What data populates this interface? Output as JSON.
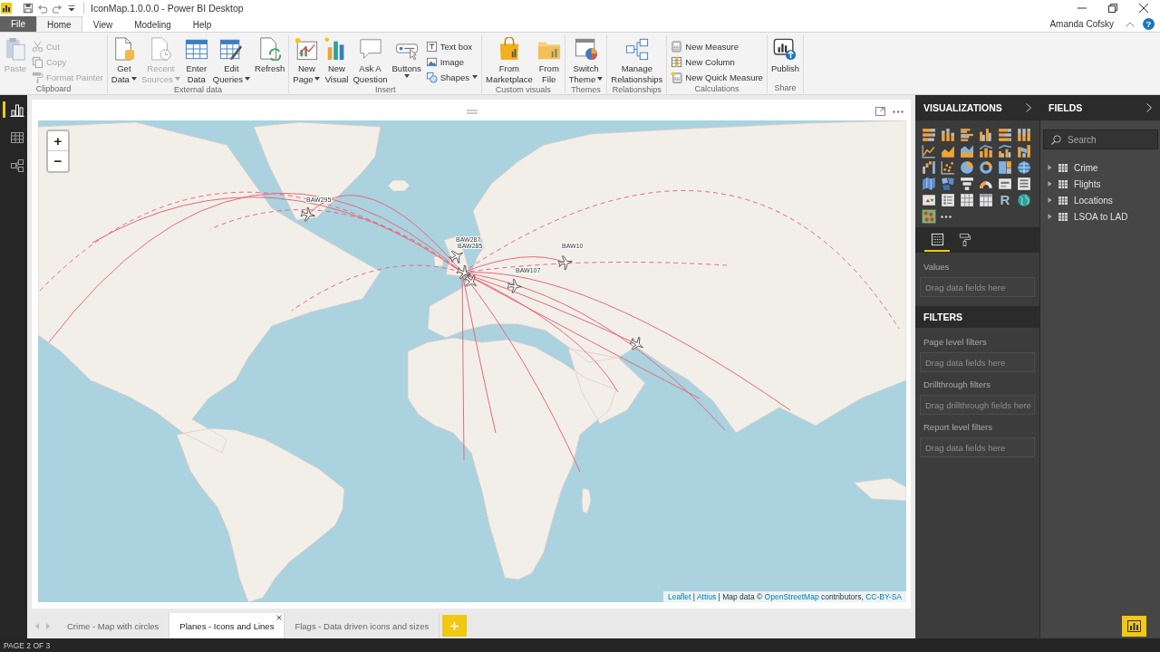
{
  "window": {
    "title": "IconMap.1.0.0.0 - Power BI Desktop"
  },
  "quick_access": [
    {
      "kind": "save"
    },
    {
      "kind": "undo"
    },
    {
      "kind": "redo"
    },
    {
      "kind": "customize"
    }
  ],
  "menu": {
    "file": "File",
    "tabs": [
      {
        "label": "Home",
        "selected": true
      },
      {
        "label": "View",
        "selected": false
      },
      {
        "label": "Modeling",
        "selected": false
      },
      {
        "label": "Help",
        "selected": false
      }
    ],
    "user": "Amanda Cofsky",
    "help": "?"
  },
  "ribbon": [
    {
      "label": "Clipboard",
      "items": [
        {
          "kind": "paste",
          "lines": [
            "Paste"
          ],
          "dropdown": false,
          "disabled": true
        },
        {
          "stack": [
            {
              "kind": "cut",
              "label": "Cut",
              "dropdown": false,
              "disabled": true
            },
            {
              "kind": "copy",
              "label": "Copy",
              "dropdown": false,
              "disabled": true
            },
            {
              "kind": "format-painter",
              "label": "Format Painter",
              "dropdown": false,
              "disabled": true
            }
          ]
        }
      ]
    },
    {
      "label": "External data",
      "items": [
        {
          "kind": "get-data",
          "lines": [
            "Get",
            "Data"
          ],
          "dropdown": true,
          "disabled": false
        },
        {
          "kind": "recent-sources",
          "lines": [
            "Recent",
            "Sources"
          ],
          "dropdown": true,
          "disabled": true
        },
        {
          "kind": "enter-data",
          "lines": [
            "Enter",
            "Data"
          ],
          "dropdown": false,
          "disabled": false
        },
        {
          "kind": "edit-queries",
          "lines": [
            "Edit",
            "Queries"
          ],
          "dropdown": true,
          "disabled": false
        },
        {
          "kind": "refresh",
          "lines": [
            "Refresh"
          ],
          "dropdown": false,
          "disabled": false
        }
      ]
    },
    {
      "label": "Insert",
      "items": [
        {
          "kind": "new-page",
          "lines": [
            "New",
            "Page"
          ],
          "dropdown": true,
          "disabled": false
        },
        {
          "kind": "new-visual",
          "lines": [
            "New",
            "Visual"
          ],
          "dropdown": false,
          "disabled": false
        },
        {
          "kind": "ask-a-question",
          "lines": [
            "Ask A",
            "Question"
          ],
          "dropdown": false,
          "disabled": false
        },
        {
          "kind": "buttons",
          "lines": [
            "Buttons"
          ],
          "dropdown": true,
          "disabled": false
        },
        {
          "stack": [
            {
              "kind": "text-box",
              "label": "Text box",
              "dropdown": false,
              "disabled": false
            },
            {
              "kind": "image",
              "label": "Image",
              "dropdown": false,
              "disabled": false
            },
            {
              "kind": "shapes",
              "label": "Shapes",
              "dropdown": true,
              "disabled": false
            }
          ]
        }
      ]
    },
    {
      "label": "Custom visuals",
      "items": [
        {
          "kind": "from-marketplace",
          "lines": [
            "From",
            "Marketplace"
          ],
          "dropdown": false,
          "disabled": false
        },
        {
          "kind": "from-file",
          "lines": [
            "From",
            "File"
          ],
          "dropdown": false,
          "disabled": false
        }
      ]
    },
    {
      "label": "Themes",
      "items": [
        {
          "kind": "switch-theme",
          "lines": [
            "Switch",
            "Theme"
          ],
          "dropdown": true,
          "disabled": false
        }
      ]
    },
    {
      "label": "Relationships",
      "items": [
        {
          "kind": "manage-relationships",
          "lines": [
            "Manage",
            "Relationships"
          ],
          "dropdown": false,
          "disabled": false
        }
      ]
    },
    {
      "label": "Calculations",
      "items": [
        {
          "stack": [
            {
              "kind": "new-measure",
              "label": "New Measure",
              "dropdown": false,
              "disabled": false
            },
            {
              "kind": "new-column",
              "label": "New Column",
              "dropdown": false,
              "disabled": false
            },
            {
              "kind": "new-quick-measure",
              "label": "New Quick Measure",
              "dropdown": false,
              "disabled": false
            }
          ]
        }
      ]
    },
    {
      "label": "Share",
      "items": [
        {
          "kind": "publish",
          "lines": [
            "Publish"
          ],
          "dropdown": false,
          "disabled": false
        }
      ]
    }
  ],
  "views": [
    {
      "kind": "report",
      "selected": true
    },
    {
      "kind": "data",
      "selected": false
    },
    {
      "kind": "model",
      "selected": false
    }
  ],
  "report": {
    "map": {
      "zoom_in": "+",
      "zoom_out": "−",
      "flights": [
        {
          "label": "BAW295"
        },
        {
          "label": "BAW287"
        },
        {
          "label": "BAW285"
        },
        {
          "label": "BAW10"
        },
        {
          "label": "BAW107"
        }
      ],
      "attribution": [
        {
          "kind": "link",
          "text": "Leaflet"
        },
        {
          "kind": "text",
          "text": "|"
        },
        {
          "kind": "link",
          "text": "Attius"
        },
        {
          "kind": "text",
          "text": "| Map data ©"
        },
        {
          "kind": "link",
          "text": "OpenStreetMap"
        },
        {
          "kind": "text",
          "text": "contributors,"
        },
        {
          "kind": "link",
          "text": "CC-BY-SA"
        }
      ]
    }
  },
  "page_tabs": [
    {
      "label": "Crime - Map with circles",
      "selected": false
    },
    {
      "label": "Planes - Icons and Lines",
      "selected": true
    },
    {
      "label": "Flags - Data driven icons and sizes",
      "selected": false
    }
  ],
  "visualizations": {
    "title": "VISUALIZATIONS",
    "visuals": [
      {
        "kind": "stacked-bar-chart"
      },
      {
        "kind": "stacked-column-chart"
      },
      {
        "kind": "clustered-bar-chart"
      },
      {
        "kind": "clustered-column-chart"
      },
      {
        "kind": "full-stacked-bar-chart"
      },
      {
        "kind": "full-stacked-column-chart"
      },
      {
        "kind": "line-chart"
      },
      {
        "kind": "area-chart"
      },
      {
        "kind": "stacked-area-chart"
      },
      {
        "kind": "line-and-column-chart"
      },
      {
        "kind": "line-and-clustered-column-chart"
      },
      {
        "kind": "ribbon-chart"
      },
      {
        "kind": "waterfall-chart"
      },
      {
        "kind": "scatter-chart"
      },
      {
        "kind": "pie-chart"
      },
      {
        "kind": "donut-chart"
      },
      {
        "kind": "treemap"
      },
      {
        "kind": "globe"
      },
      {
        "kind": "filled-map"
      },
      {
        "kind": "shape-map"
      },
      {
        "kind": "funnel-chart"
      },
      {
        "kind": "gauge"
      },
      {
        "kind": "card"
      },
      {
        "kind": "multi-row-card"
      },
      {
        "kind": "kpi"
      },
      {
        "kind": "slicer"
      },
      {
        "kind": "table"
      },
      {
        "kind": "matrix"
      },
      {
        "kind": "letter",
        "glyph": "R"
      },
      {
        "kind": "land-globe"
      },
      {
        "kind": "dot-map"
      }
    ],
    "tabs": [
      {
        "kind": "fields",
        "selected": true
      },
      {
        "kind": "format",
        "selected": false
      }
    ],
    "wells": [
      {
        "label": "Values",
        "placeholder": "Drag data fields here"
      }
    ]
  },
  "filters": {
    "title": "FILTERS",
    "sections": [
      {
        "label": "Page level filters",
        "placeholder": "Drag data fields here"
      },
      {
        "label": "Drillthrough filters",
        "placeholder": "Drag drillthrough fields here"
      },
      {
        "label": "Report level filters",
        "placeholder": "Drag data fields here"
      }
    ]
  },
  "fields": {
    "title": "FIELDS",
    "search": {
      "placeholder": "Search"
    },
    "tables": [
      {
        "name": "Crime",
        "expanded": false
      },
      {
        "name": "Flights",
        "expanded": false
      },
      {
        "name": "Locations",
        "expanded": false
      },
      {
        "name": "LSOA to LAD",
        "expanded": false
      }
    ]
  },
  "status_bar": {
    "text": "PAGE 2 OF 3"
  }
}
